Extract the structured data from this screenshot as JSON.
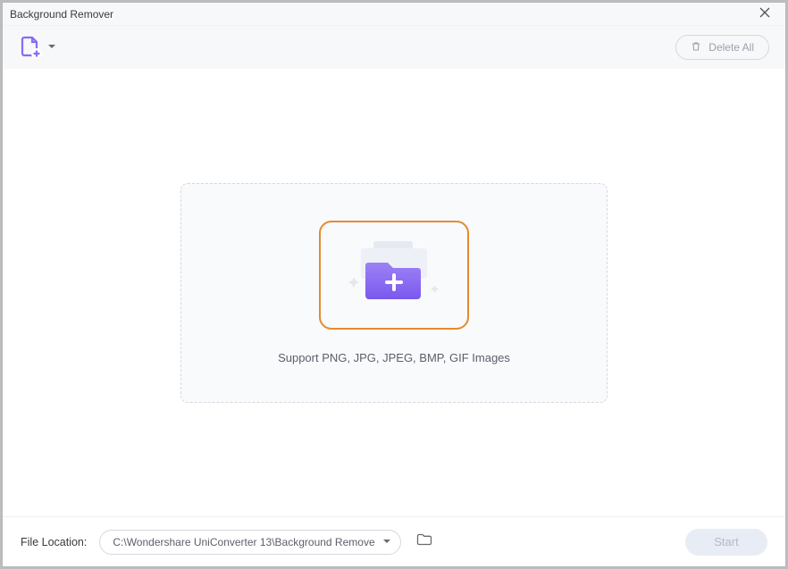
{
  "window": {
    "title": "Background Remover"
  },
  "toolbar": {
    "delete_all_label": "Delete All"
  },
  "dropzone": {
    "support_text": "Support PNG, JPG, JPEG, BMP, GIF Images"
  },
  "footer": {
    "location_label": "File Location:",
    "path": "C:\\Wondershare UniConverter 13\\Background Remove",
    "start_label": "Start"
  },
  "colors": {
    "accent": "#8a6cf0",
    "highlight": "#e68a2e"
  }
}
